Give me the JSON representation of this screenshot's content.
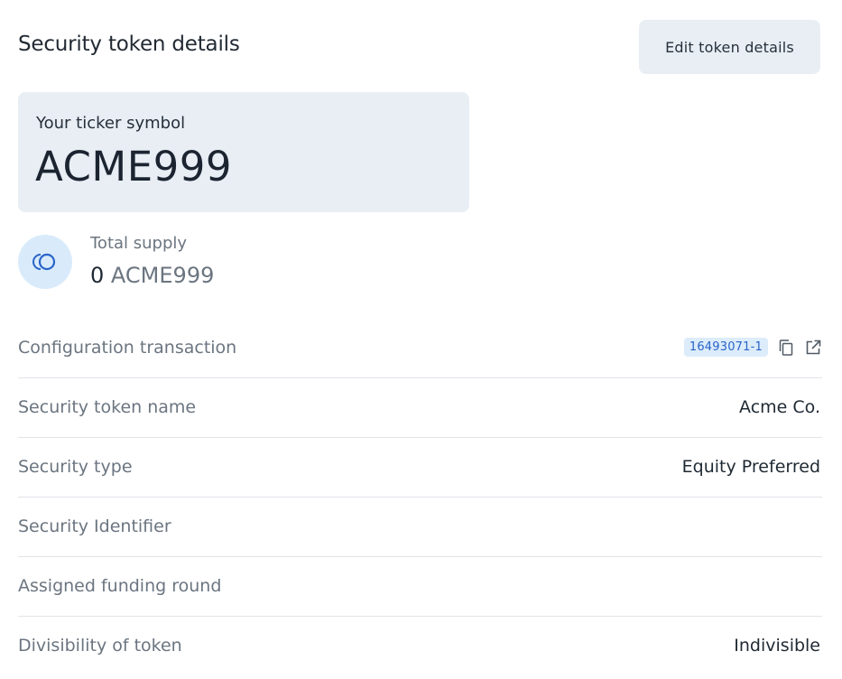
{
  "header": {
    "title": "Security token details",
    "edit_button_label": "Edit token details"
  },
  "ticker": {
    "label": "Your ticker symbol",
    "value": "ACME999"
  },
  "supply": {
    "label": "Total supply",
    "amount": "0",
    "unit": "ACME999",
    "icon": "coins-icon"
  },
  "details": {
    "configuration_transaction": {
      "label": "Configuration transaction",
      "tx_id": "16493071-1",
      "copy_icon": "copy-icon",
      "open_icon": "external-link-icon"
    },
    "token_name": {
      "label": "Security token name",
      "value": "Acme Co."
    },
    "security_type": {
      "label": "Security type",
      "value": "Equity Preferred"
    },
    "security_identifier": {
      "label": "Security Identifier",
      "value": ""
    },
    "funding_round": {
      "label": "Assigned funding round",
      "value": ""
    },
    "divisibility": {
      "label": "Divisibility of token",
      "value": "Indivisible"
    }
  },
  "colors": {
    "card_bg": "#e9eef5",
    "icon_circle_bg": "#d9ebfb",
    "accent_blue": "#2a64c9",
    "muted_text": "#6b7580"
  }
}
